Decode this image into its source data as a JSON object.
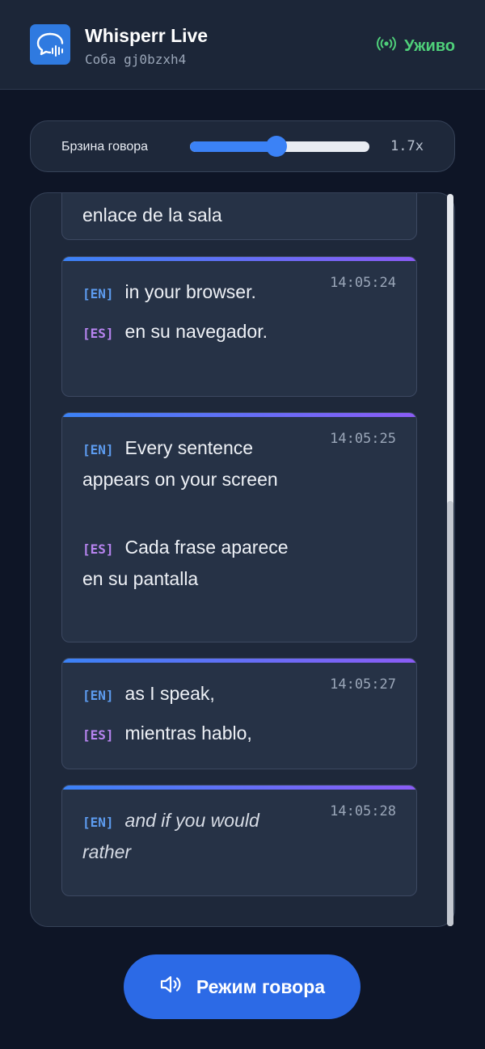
{
  "header": {
    "title": "Whisperr Live",
    "room": "Соба gj0bzxh4",
    "status": "Уживо",
    "status_color": "#4fd07a",
    "logo_icon": "chat-bubble-waveform-icon",
    "status_icon": "broadcast-icon"
  },
  "speed": {
    "label": "Брзина говора",
    "value_text": "1.7x",
    "fill_fraction": 0.48
  },
  "feed": {
    "partial_card_text": "enlace de la sala",
    "cards": [
      {
        "time": "14:05:24",
        "en_tag": "[EN]",
        "en": "in your browser.",
        "es_tag": "[ES]",
        "es": "en su navegador."
      },
      {
        "time": "14:05:25",
        "en_tag": "[EN]",
        "en": "Every sentence appears on your screen",
        "es_tag": "[ES]",
        "es": "Cada frase aparece en su pantalla"
      },
      {
        "time": "14:05:27",
        "en_tag": "[EN]",
        "en": "as I speak,",
        "es_tag": "[ES]",
        "es": "mientras hablo,"
      },
      {
        "time": "14:05:28",
        "en_tag": "[EN]",
        "en": "and if you would rather"
      }
    ]
  },
  "speak_button": {
    "label": "Режим говора",
    "icon": "speaker-icon"
  },
  "colors": {
    "accent": "#3b82f6",
    "en_tag": "#5d9cf0",
    "es_tag": "#b784f0"
  }
}
